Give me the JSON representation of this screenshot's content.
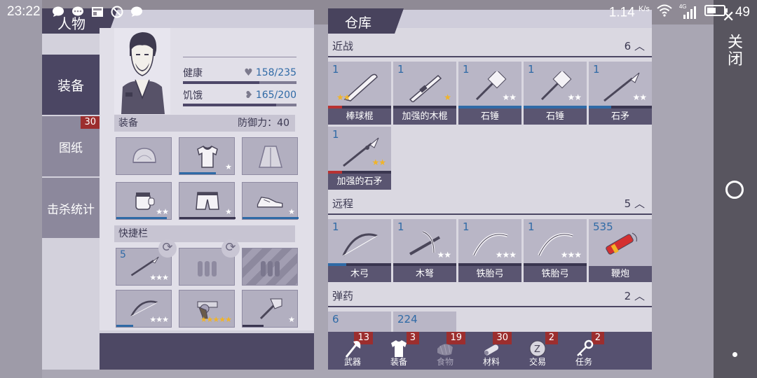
{
  "status_bar": {
    "time": "23:22",
    "speed_value": "1.14",
    "speed_unit": "K/s",
    "network": "4G",
    "battery": "49"
  },
  "character_panel": {
    "title": "人物",
    "side_tabs": [
      {
        "label": "装备",
        "active": true
      },
      {
        "label": "图纸",
        "badge": "30"
      },
      {
        "label": "击杀统计"
      }
    ],
    "stats": {
      "health_label": "健康",
      "health_value": "158/235",
      "health_fraction": 0.67,
      "hunger_label": "饥饿",
      "hunger_value": "165/200",
      "hunger_fraction": 0.82
    },
    "equipment_section": {
      "label": "装备",
      "defense_label": "防御力：40"
    },
    "equipment_slots": [
      {
        "icon": "helmet-icon",
        "stars": ""
      },
      {
        "icon": "shirt-icon",
        "stars": "★"
      },
      {
        "icon": "cloak-icon",
        "stars": ""
      },
      {
        "icon": "gloves-icon",
        "stars": "★★"
      },
      {
        "icon": "shorts-icon",
        "stars": "★"
      },
      {
        "icon": "shoes-icon",
        "stars": "★"
      }
    ],
    "quickbar_label": "快捷栏",
    "quickbar_slots": [
      {
        "icon": "spear-icon",
        "qty": "5",
        "stars": "★★★"
      },
      {
        "icon": "ammo-icon",
        "qty": "",
        "stars": ""
      },
      {
        "icon": "ammo-locked-icon",
        "qty": "",
        "stars": ""
      },
      {
        "icon": "bow-icon",
        "qty": "",
        "stars": "★★★"
      },
      {
        "icon": "revolver-icon",
        "qty": "",
        "stars": "★★★★★"
      },
      {
        "icon": "hammer-icon",
        "qty": "",
        "stars": "★"
      }
    ]
  },
  "warehouse": {
    "title": "仓库",
    "categories": [
      {
        "name": "近战",
        "count": "6",
        "items": [
          {
            "qty": "1",
            "name": "棒球棍",
            "stars": "★★",
            "gold": true,
            "icon": "bat-icon"
          },
          {
            "qty": "1",
            "name": "加强的木棍",
            "stars": "★",
            "gold": true,
            "icon": "reinforced-stick-icon"
          },
          {
            "qty": "1",
            "name": "石锤",
            "stars": "★★",
            "gold": false,
            "icon": "stone-hammer-icon"
          },
          {
            "qty": "1",
            "name": "石锤",
            "stars": "★★",
            "gold": false,
            "icon": "stone-hammer-icon"
          },
          {
            "qty": "1",
            "name": "石矛",
            "stars": "★★",
            "gold": false,
            "icon": "stone-spear-icon"
          },
          {
            "qty": "1",
            "name": "加强的石矛",
            "stars": "★★",
            "gold": true,
            "icon": "reinforced-spear-icon"
          }
        ]
      },
      {
        "name": "远程",
        "count": "5",
        "items": [
          {
            "qty": "1",
            "name": "木弓",
            "stars": "",
            "gold": false,
            "icon": "wood-bow-icon"
          },
          {
            "qty": "1",
            "name": "木弩",
            "stars": "★★",
            "gold": false,
            "icon": "crossbow-icon"
          },
          {
            "qty": "1",
            "name": "铁胎弓",
            "stars": "★★★",
            "gold": false,
            "icon": "iron-bow-icon"
          },
          {
            "qty": "1",
            "name": "铁胎弓",
            "stars": "★★★",
            "gold": false,
            "icon": "iron-bow-icon"
          },
          {
            "qty": "535",
            "name": "鞭炮",
            "stars": "",
            "gold": false,
            "icon": "firecracker-icon"
          }
        ]
      },
      {
        "name": "弹药",
        "count": "2",
        "items": [
          {
            "qty": "6"
          },
          {
            "qty": "224"
          }
        ]
      }
    ],
    "bottom_tabs": [
      {
        "label": "武器",
        "badge": "13",
        "icon": "axe-icon"
      },
      {
        "label": "装备",
        "badge": "3",
        "icon": "tshirt-icon"
      },
      {
        "label": "食物",
        "badge": "19",
        "icon": "food-icon"
      },
      {
        "label": "材料",
        "badge": "30",
        "icon": "material-icon"
      },
      {
        "label": "交易",
        "badge": "2",
        "icon": "trade-coin-icon"
      },
      {
        "label": "任务",
        "badge": "2",
        "icon": "key-icon"
      }
    ]
  },
  "system": {
    "close_label": "关闭"
  },
  "colors": {
    "panel_dark": "#4b4663",
    "accent_blue": "#2f6aa6",
    "badge_red": "#9c2e2e",
    "star_gold": "#f1b428"
  }
}
